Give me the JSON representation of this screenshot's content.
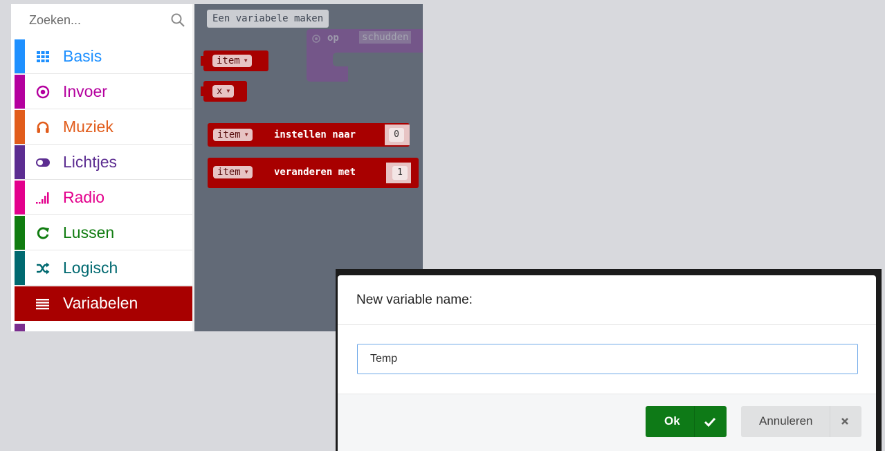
{
  "toolbox": {
    "search_placeholder": "Zoeken...",
    "categories": [
      {
        "label": "Basis",
        "icon": "grid-icon",
        "color": "#1e90ff"
      },
      {
        "label": "Invoer",
        "icon": "target-icon",
        "color": "#b4009e"
      },
      {
        "label": "Muziek",
        "icon": "headphones-icon",
        "color": "#e15c1b"
      },
      {
        "label": "Lichtjes",
        "icon": "toggle-icon",
        "color": "#5c2d91"
      },
      {
        "label": "Radio",
        "icon": "signal-bars-icon",
        "color": "#e3008c"
      },
      {
        "label": "Lussen",
        "icon": "refresh-icon",
        "color": "#107c10"
      },
      {
        "label": "Logisch",
        "icon": "shuffle-icon",
        "color": "#006970"
      },
      {
        "label": "Variabelen",
        "icon": "list-icon",
        "color": "#a80000"
      }
    ]
  },
  "flyout": {
    "make_variable_label": "Een variabele maken",
    "ghost_block": {
      "label": "op",
      "field": "schudden"
    },
    "blocks": [
      {
        "var": "item"
      },
      {
        "var": "x"
      },
      {
        "var": "item",
        "text": "instellen naar",
        "value": "0"
      },
      {
        "var": "item",
        "text": "veranderen met",
        "value": "1"
      }
    ]
  },
  "dialog": {
    "title": "New variable name:",
    "input_value": "Temp",
    "ok_label": "Ok",
    "cancel_label": "Annuleren"
  },
  "colors": {
    "accent_variables": "#a80000",
    "ok_green": "#0e7a17",
    "workspace": "#626a77"
  }
}
